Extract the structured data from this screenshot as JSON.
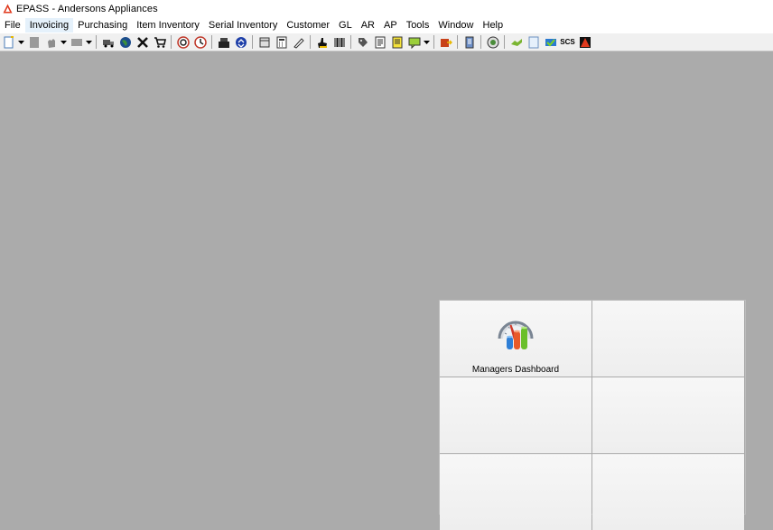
{
  "window": {
    "title": "EPASS  -  Andersons Appliances",
    "logo_icon": "epass-logo-icon"
  },
  "menu": [
    {
      "label": "File"
    },
    {
      "label": "Invoicing",
      "active": true
    },
    {
      "label": "Purchasing"
    },
    {
      "label": "Item Inventory"
    },
    {
      "label": "Serial Inventory"
    },
    {
      "label": "Customer"
    },
    {
      "label": "GL"
    },
    {
      "label": "AR"
    },
    {
      "label": "AP"
    },
    {
      "label": "Tools"
    },
    {
      "label": "Window"
    },
    {
      "label": "Help"
    }
  ],
  "toolbar": {
    "scs_label": "SCS"
  },
  "dashboard": {
    "tiles": [
      {
        "label": "Managers Dashboard",
        "icon": "managers-dashboard-icon"
      },
      {
        "label": ""
      },
      {
        "label": ""
      },
      {
        "label": ""
      },
      {
        "label": ""
      },
      {
        "label": ""
      }
    ]
  },
  "colors": {
    "workspace": "#ababab",
    "menu_highlight": "#e5f1fb",
    "toolbar_bg": "#f0f0f0"
  }
}
